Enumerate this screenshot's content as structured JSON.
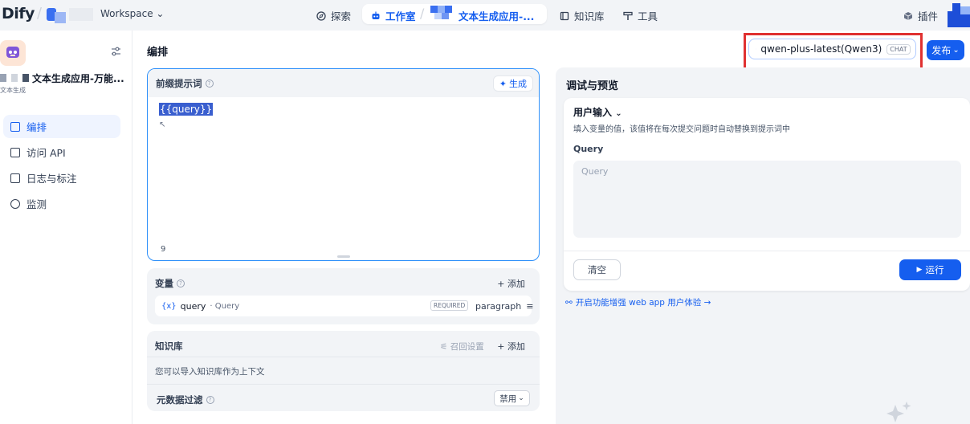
{
  "topnav": {
    "logo": "Dify",
    "workspace": "Workspace",
    "explore": "探索",
    "studio": "工作室",
    "app_name": "文本生成应用-...",
    "knowledge": "知识库",
    "tools": "工具",
    "plugins": "插件"
  },
  "sidebar": {
    "app_name": "文本生成应用-万能...",
    "app_type": "文本生成",
    "items": [
      {
        "label": "编排",
        "active": true
      },
      {
        "label": "访问 API",
        "active": false
      },
      {
        "label": "日志与标注",
        "active": false
      },
      {
        "label": "监测",
        "active": false
      }
    ]
  },
  "main": {
    "title": "编排",
    "model": {
      "name": "qwen-plus-latest(Qwen3)",
      "mode": "CHAT"
    },
    "publish": "发布",
    "prompt": {
      "title": "前缀提示词",
      "generate": "生成",
      "content": "{{query}}",
      "char_count": "9"
    },
    "variables": {
      "title": "变量",
      "add": "+ 添加",
      "rows": [
        {
          "icon": "{x}",
          "key": "query",
          "label": "· Query",
          "required": "REQUIRED",
          "type": "paragraph"
        }
      ]
    },
    "knowledge": {
      "title": "知识库",
      "recall": "召回设置",
      "add": "+ 添加",
      "desc": "您可以导入知识库作为上下文"
    },
    "metadata": {
      "title": "元数据过滤",
      "value": "禁用"
    }
  },
  "debug": {
    "title": "调试与预览",
    "user_input": "用户输入",
    "user_input_desc": "填入变量的值，该值将在每次提交问题时自动替换到提示词中",
    "query_label": "Query",
    "query_placeholder": "Query",
    "clear": "清空",
    "run": "运行",
    "feature_link": "开启功能增强 web app 用户体验 →"
  }
}
